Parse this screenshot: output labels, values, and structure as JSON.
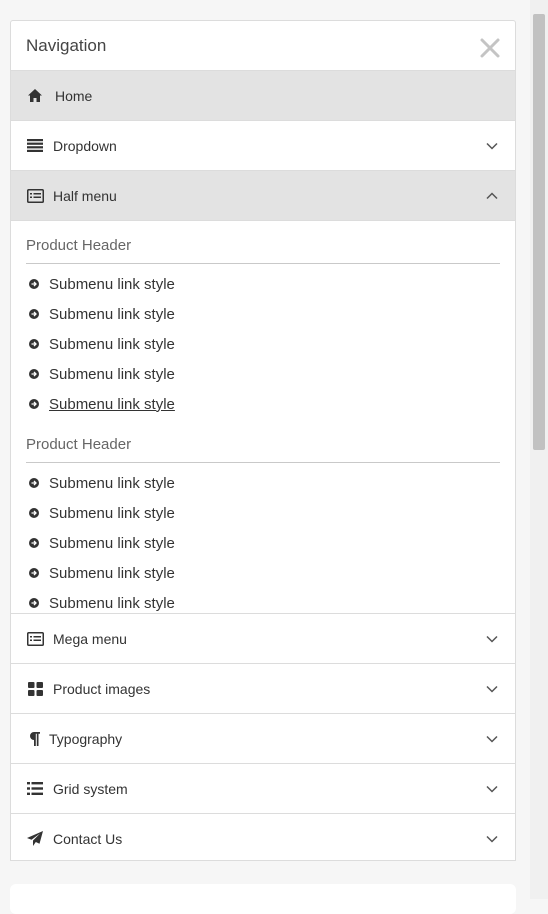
{
  "panel": {
    "title": "Navigation",
    "close_icon": "close-icon"
  },
  "items": [
    {
      "label": "Home",
      "icon": "home-icon"
    },
    {
      "label": "Dropdown",
      "icon": "list-lines-icon"
    },
    {
      "label": "Half menu",
      "icon": "card-list-icon"
    },
    {
      "label": "Mega menu",
      "icon": "card-list-icon"
    },
    {
      "label": "Product images",
      "icon": "grid-icon"
    },
    {
      "label": "Typography",
      "icon": "paragraph-icon"
    },
    {
      "label": "Grid system",
      "icon": "bullet-list-icon"
    },
    {
      "label": "Contact Us",
      "icon": "paper-plane-icon"
    }
  ],
  "half_menu": {
    "groups": [
      {
        "header": "Product Header",
        "links": [
          "Submenu link style",
          "Submenu link style",
          "Submenu link style",
          "Submenu link style",
          "Submenu link style"
        ]
      },
      {
        "header": "Product Header",
        "links": [
          "Submenu link style",
          "Submenu link style",
          "Submenu link style",
          "Submenu link style",
          "Submenu link style"
        ]
      }
    ]
  },
  "colors": {
    "active_bg": "#e3e3e3",
    "border": "#dcdcdc",
    "text": "#333333"
  }
}
